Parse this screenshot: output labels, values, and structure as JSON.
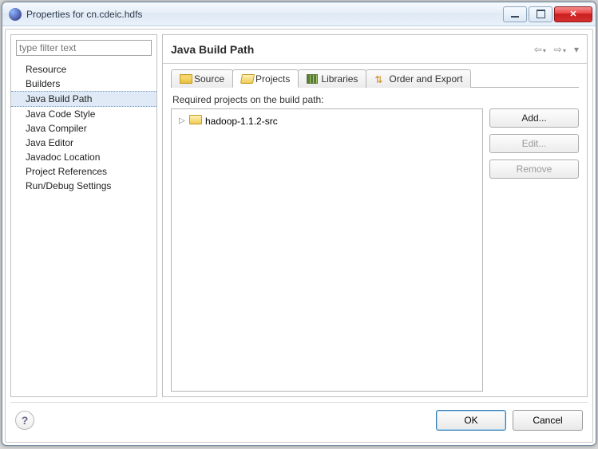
{
  "window": {
    "title": "Properties for cn.cdeic.hdfs"
  },
  "nav": {
    "items": [
      {
        "label": "Resource"
      },
      {
        "label": "Builders"
      },
      {
        "label": "Java Build Path",
        "selected": true
      },
      {
        "label": "Java Code Style"
      },
      {
        "label": "Java Compiler"
      },
      {
        "label": "Java Editor"
      },
      {
        "label": "Javadoc Location"
      },
      {
        "label": "Project References"
      },
      {
        "label": "Run/Debug Settings"
      }
    ],
    "filter_placeholder": "type filter text"
  },
  "page": {
    "title": "Java Build Path",
    "tabs": [
      {
        "label": "Source",
        "icon": "folder"
      },
      {
        "label": "Projects",
        "icon": "folder-open",
        "active": true
      },
      {
        "label": "Libraries",
        "icon": "lib"
      },
      {
        "label": "Order and Export",
        "icon": "order"
      }
    ],
    "required_label": "Required projects on the build path:",
    "tree": {
      "items": [
        {
          "label": "hadoop-1.1.2-src"
        }
      ]
    },
    "buttons": {
      "add": "Add...",
      "edit": "Edit...",
      "remove": "Remove"
    }
  },
  "footer": {
    "ok": "OK",
    "cancel": "Cancel"
  }
}
